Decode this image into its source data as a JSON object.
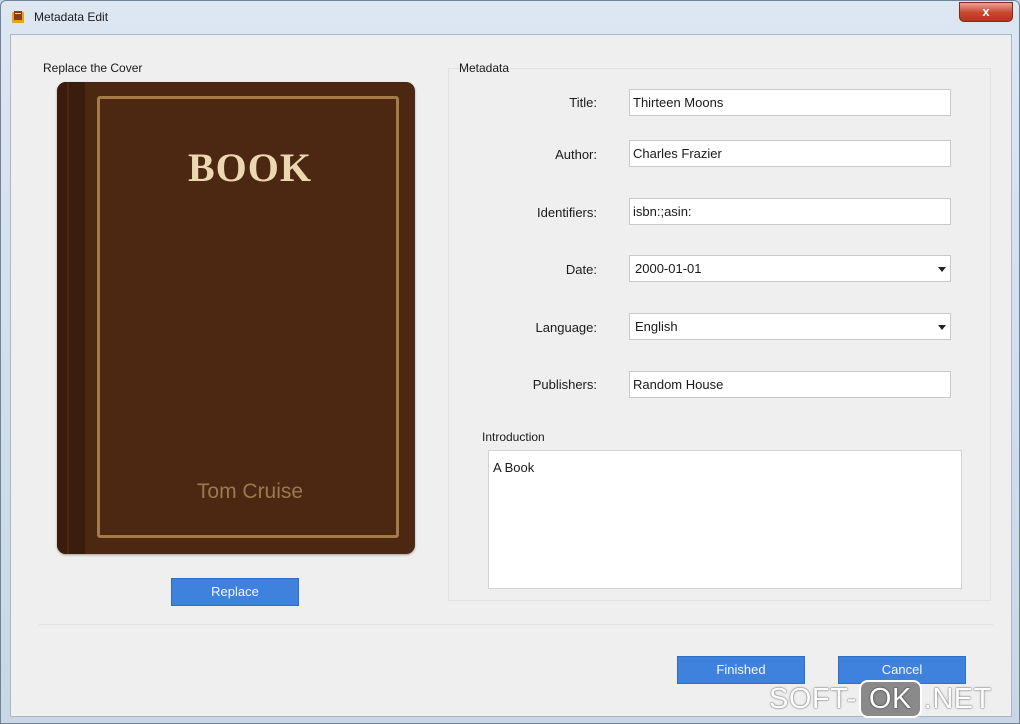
{
  "window": {
    "title": "Metadata Edit",
    "close_symbol": "x",
    "app_icon": "book-app-icon",
    "close_icon": "close-icon"
  },
  "cover_section": {
    "label": "Replace the Cover",
    "cover_title": "BOOK",
    "cover_author": "Tom Cruise",
    "replace_button": "Replace"
  },
  "metadata": {
    "label": "Metadata",
    "fields": {
      "title": {
        "label": "Title:",
        "value": "Thirteen Moons"
      },
      "author": {
        "label": "Author:",
        "value": "Charles Frazier"
      },
      "identifiers": {
        "label": "Identifiers:",
        "value": "isbn:;asin:"
      },
      "date": {
        "label": "Date:",
        "value": "2000-01-01"
      },
      "language": {
        "label": "Language:",
        "value": "English"
      },
      "publishers": {
        "label": "Publishers:",
        "value": "Random House"
      }
    },
    "introduction": {
      "label": "Introduction",
      "value": "A Book"
    }
  },
  "footer": {
    "finished_button": "Finished",
    "cancel_button": "Cancel"
  },
  "watermark": {
    "left": "SOFT-",
    "middle": "OK",
    "right": ".NET"
  },
  "colors": {
    "accent": "#3f82de",
    "cover": "#4c2712",
    "close": "#c9452e"
  }
}
